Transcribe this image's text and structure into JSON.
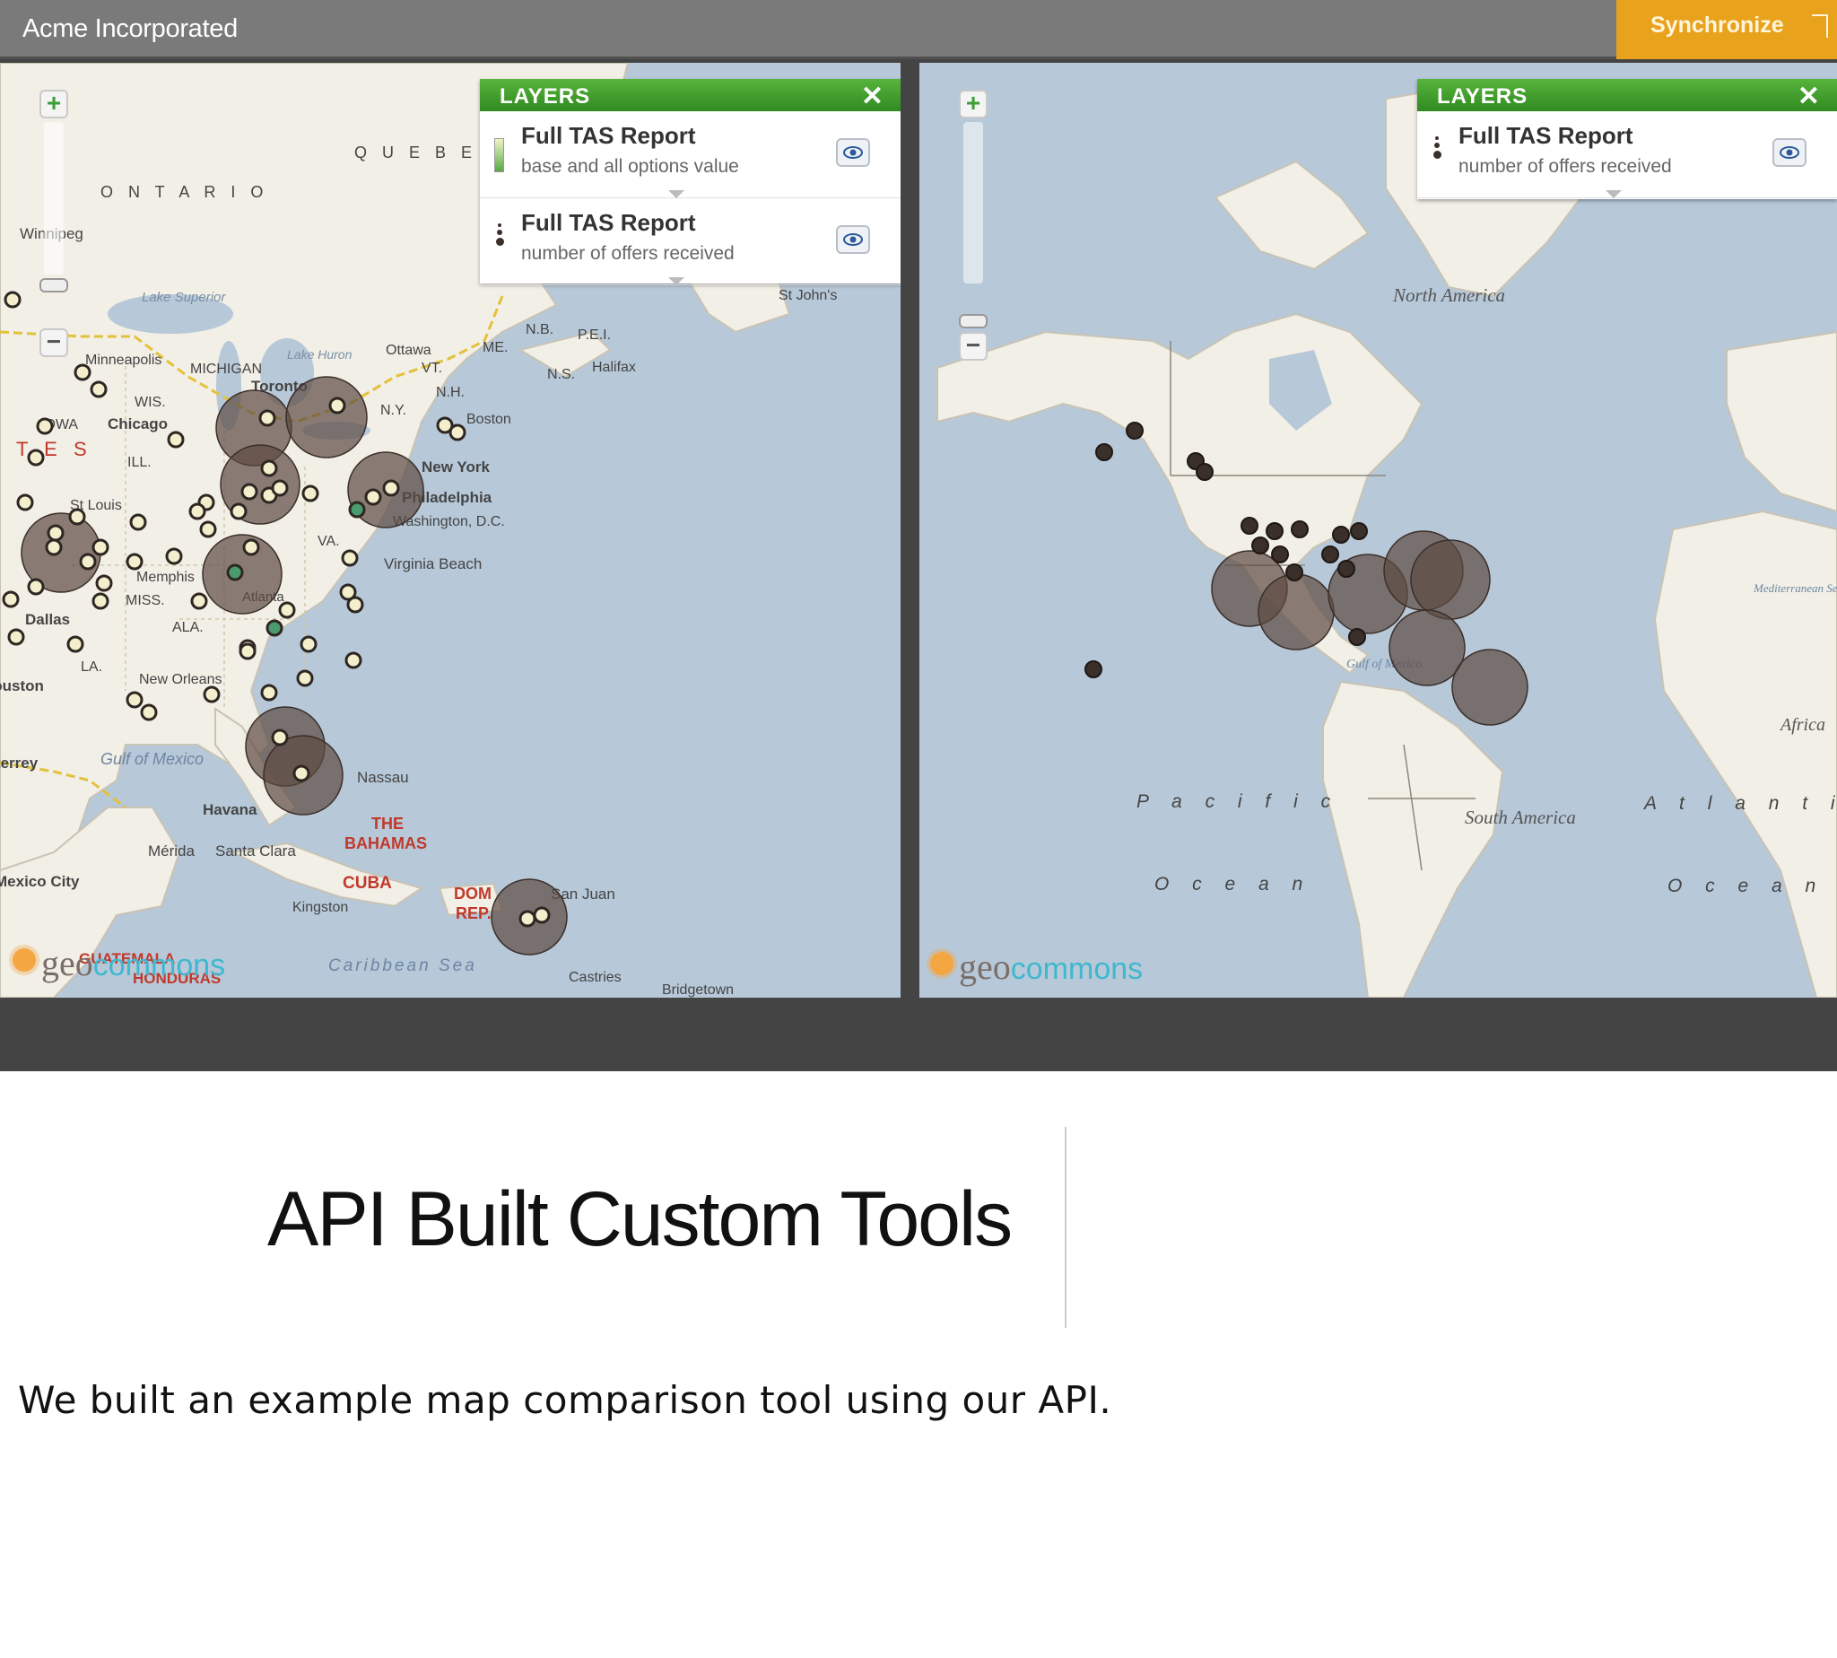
{
  "app": {
    "title": "Acme Incorporated",
    "sync_label": "Synchronize"
  },
  "maps": {
    "left": {
      "layers_title": "LAYERS",
      "layers": [
        {
          "title": "Full TAS Report",
          "subtitle": "base and all options value",
          "legend": "graduated-color"
        },
        {
          "title": "Full TAS Report",
          "subtitle": "number of offers received",
          "legend": "graduated-size"
        }
      ],
      "labels": {
        "quebec": "Q U E B E",
        "ontario": "O N T A R I O",
        "winnipeg": "Winnipeg",
        "lake_superior": "Lake Superior",
        "minneapolis": "Minneapolis",
        "michigan": "MICHIGAN",
        "lake_huron": "Lake Huron",
        "ottawa": "Ottawa",
        "toronto": "Toronto",
        "wis": "WIS.",
        "iowa": "IOWA",
        "chicago": "Chicago",
        "ill": "ILL.",
        "states": "T E S",
        "st_louis": "St Louis",
        "memphis": "Memphis",
        "miss": "MISS.",
        "ala": "ALA.",
        "dallas": "Dallas",
        "la": "LA.",
        "new_orleans": "New Orleans",
        "atlanta": "Atlanta",
        "va": "VA.",
        "ny": "N.Y.",
        "vt": "VT.",
        "me": "ME.",
        "nh": "N.H.",
        "nb": "N.B.",
        "pei": "P.E.I.",
        "ns": "N.S.",
        "halifax": "Halifax",
        "st_johns": "St John's",
        "boston": "Boston",
        "new_york": "New York",
        "philadelphia": "Philadelphia",
        "washington": "Washington, D.C.",
        "virginia_beach": "Virginia Beach",
        "gulf_of_mexico": "Gulf of Mexico",
        "monterrey": "Monterrey",
        "havana": "Havana",
        "nassau": "Nassau",
        "bahamas_1": "THE",
        "bahamas_2": "BAHAMAS",
        "merida": "Mérida",
        "santa_clara": "Santa Clara",
        "mexico_city": "Mexico City",
        "cuba": "CUBA",
        "kingston": "Kingston",
        "dom_rep_1": "DOM",
        "dom_rep_2": "REP.",
        "san_juan": "San Juan",
        "guatemala": "GUATEMALA",
        "honduras": "HONDURAS",
        "caribbean_sea": "Caribbean Sea",
        "castries": "Castries",
        "bridgetown": "Bridgetown",
        "houston": "Houston"
      }
    },
    "right": {
      "layers_title": "LAYERS",
      "layers": [
        {
          "title": "Full TAS Report",
          "subtitle": "number of offers received",
          "legend": "graduated-size"
        }
      ],
      "labels": {
        "north_america": "North America",
        "south_america": "South America",
        "pacific": "P a c i f i c",
        "pacific_ocean": "O c e a n",
        "atlantic": "A t l a n t i c",
        "atlantic_ocean": "O c e a n",
        "gulf_of_mexico": "Gulf of Mexico",
        "africa": "Africa",
        "mediterranean": "Mediterranean Sea"
      }
    },
    "logo": {
      "geo": "geo",
      "commons": "commons"
    }
  },
  "slide": {
    "title": "API Built Custom Tools",
    "body": "We built an example map comparison tool using our API."
  },
  "colors": {
    "appbar": "#7a7a7a",
    "sync": "#e9a21c",
    "layers_header": "#3f9a2a",
    "water": "#b7c8d8",
    "land": "#f2efe6",
    "bubble": "#5c4a42"
  }
}
